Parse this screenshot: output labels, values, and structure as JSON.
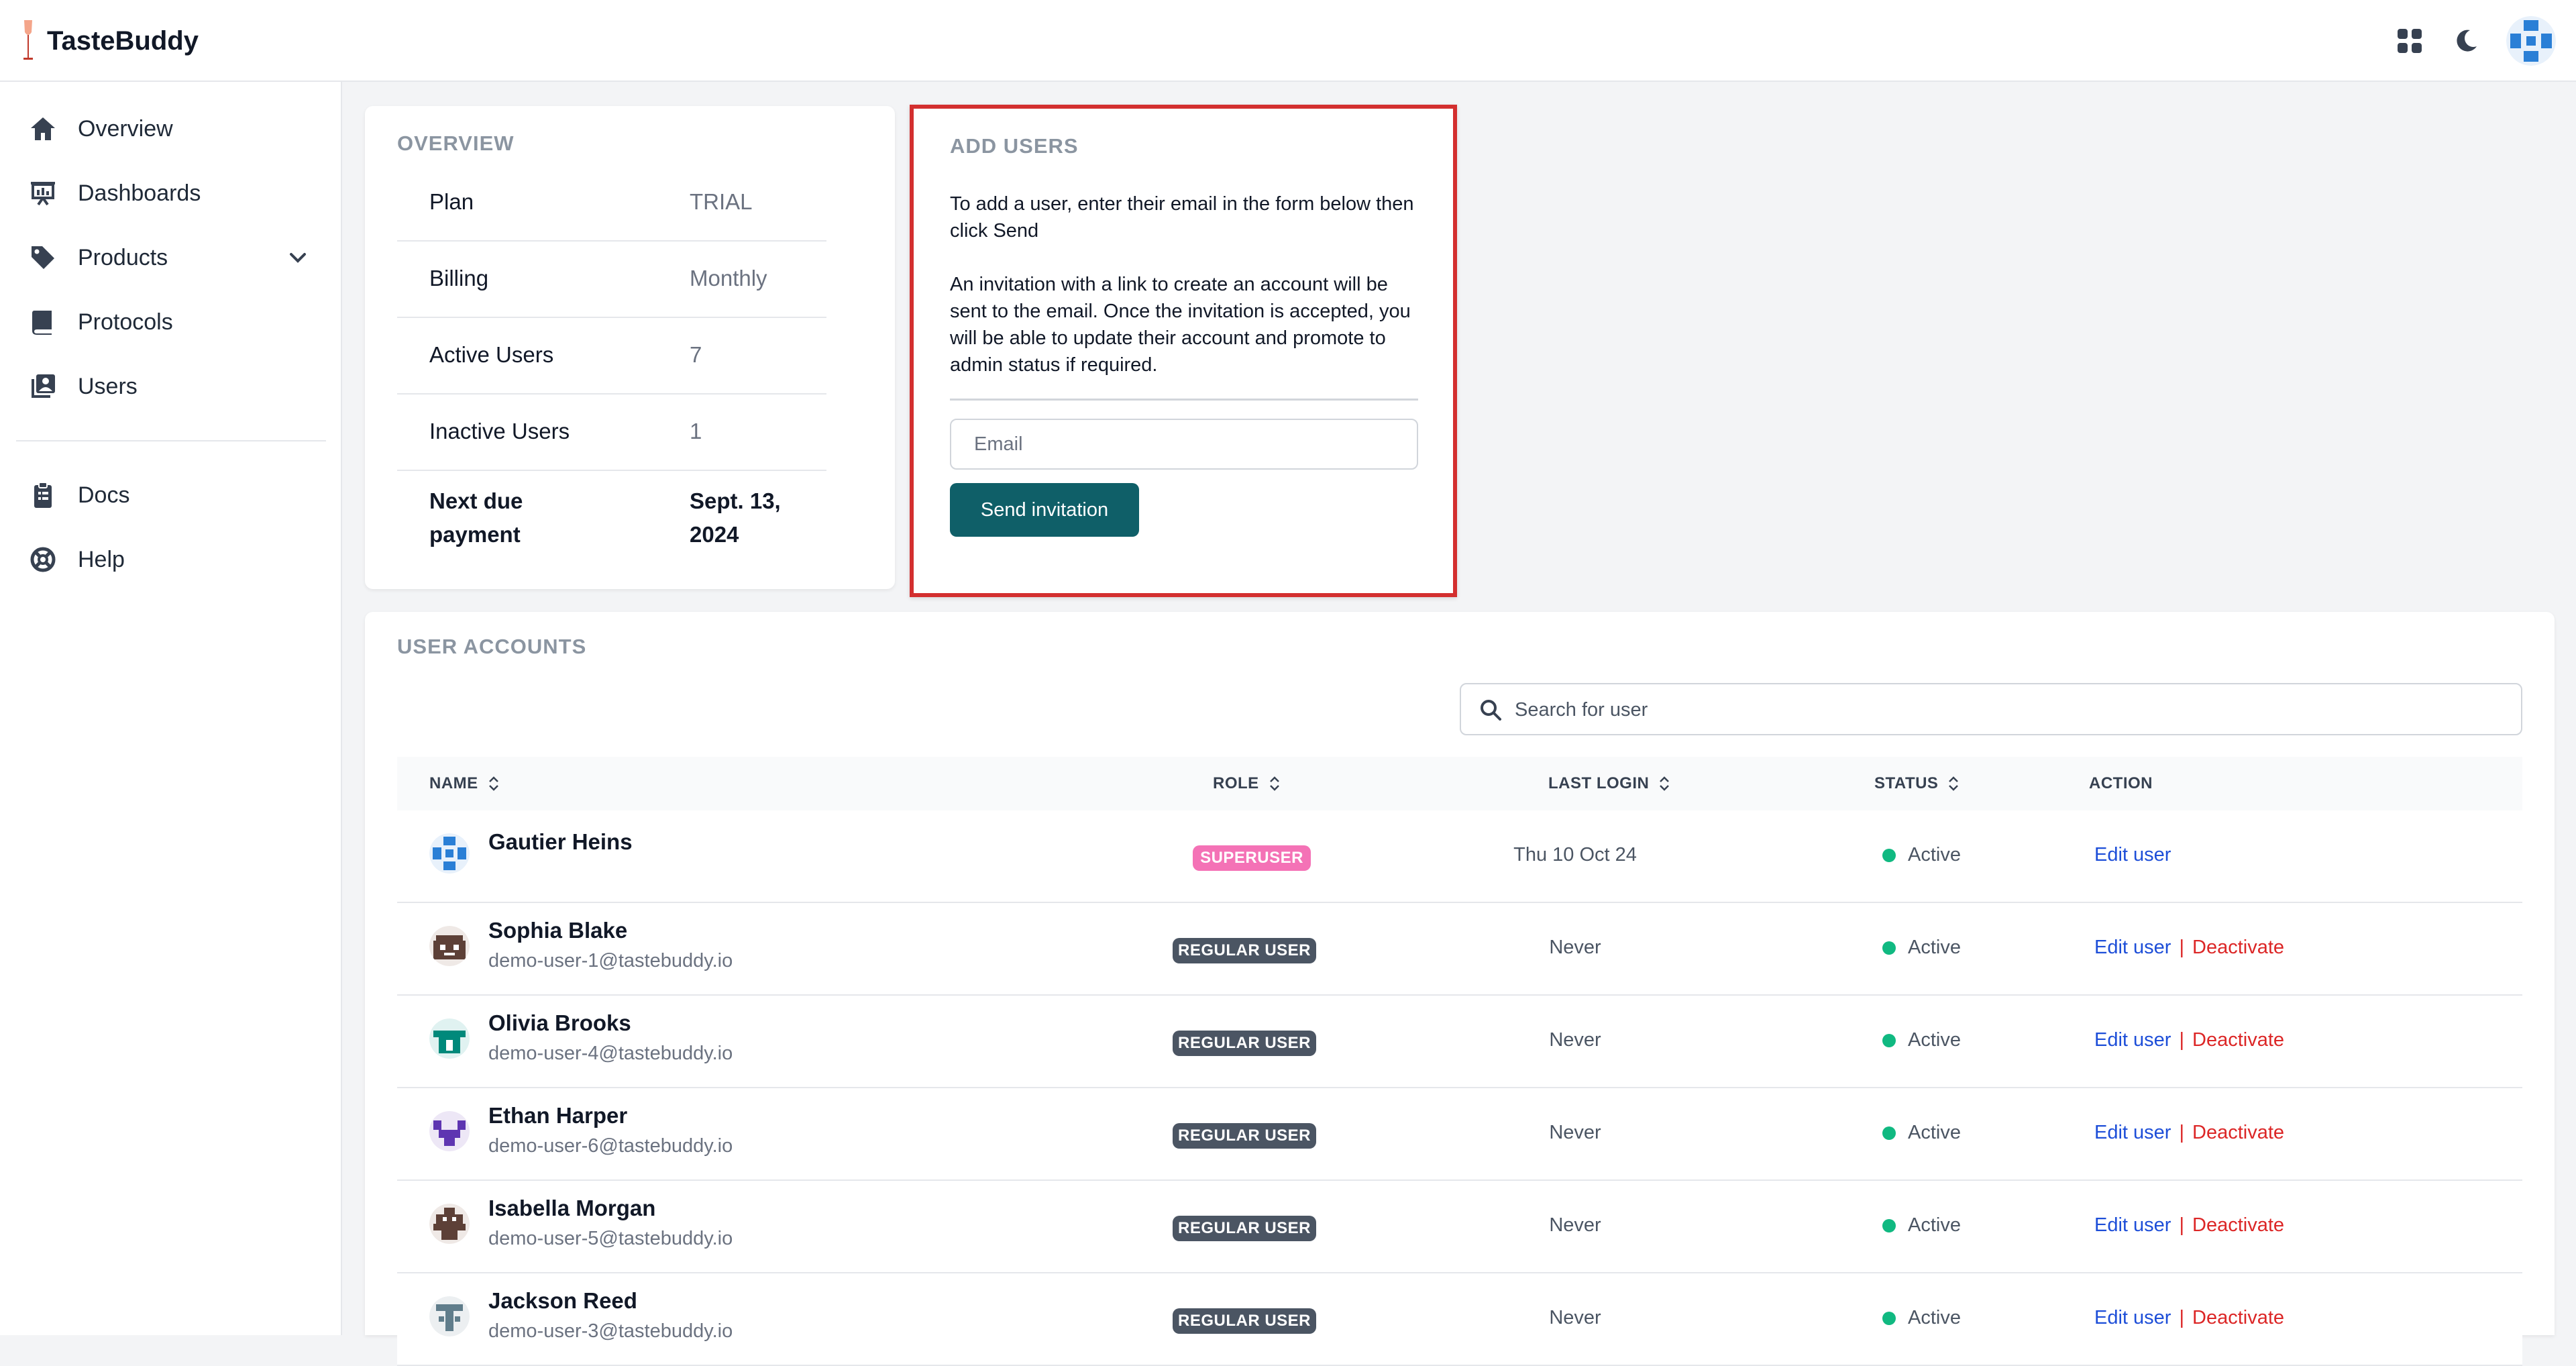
{
  "app": {
    "name": "TasteBuddy"
  },
  "colors": {
    "accent": "#0f5f68",
    "highlight_border": "#d32f2f",
    "active": "#10b981",
    "link": "#1d4ed8",
    "danger": "#dc2626",
    "superuser": "#f472b6",
    "regular": "#4b5563"
  },
  "header": {
    "icons": [
      "grid-icon",
      "moon-icon",
      "user-avatar"
    ]
  },
  "sidebar": {
    "items": [
      {
        "label": "Overview",
        "icon": "home-icon"
      },
      {
        "label": "Dashboards",
        "icon": "presentation-icon"
      },
      {
        "label": "Products",
        "icon": "tag-icon"
      },
      {
        "label": "Protocols",
        "icon": "book-icon"
      },
      {
        "label": "Users",
        "icon": "users-icon"
      }
    ],
    "footer_items": [
      {
        "label": "Docs",
        "icon": "clipboard-icon"
      },
      {
        "label": "Help",
        "icon": "lifebuoy-icon"
      }
    ]
  },
  "overview": {
    "title": "OVERVIEW",
    "rows": [
      {
        "label": "Plan",
        "value": "TRIAL"
      },
      {
        "label": "Billing",
        "value": "Monthly"
      },
      {
        "label": "Active Users",
        "value": "7"
      },
      {
        "label": "Inactive Users",
        "value": "1"
      }
    ],
    "next_due": {
      "label_line1": "Next due",
      "label_line2": "payment",
      "value_line1": "Sept. 13,",
      "value_line2": "2024"
    }
  },
  "add_users": {
    "title": "ADD USERS",
    "intro": "To add a user, enter their email in the form below then click Send",
    "detail": "An invitation with a link to create an account will be sent to the email. Once the invitation is accepted, you will be able to update their account and promote to admin status if required.",
    "email_placeholder": "Email",
    "send_label": "Send invitation"
  },
  "user_accounts": {
    "title": "USER ACCOUNTS",
    "search_placeholder": "Search for user",
    "columns": {
      "name": "NAME",
      "role": "ROLE",
      "last_login": "LAST LOGIN",
      "status": "STATUS",
      "action": "ACTION"
    },
    "edit_label": "Edit user",
    "separator": "|",
    "deactivate_label": "Deactivate",
    "rows": [
      {
        "name": "Gautier Heins",
        "email": "",
        "role": "SUPERUSER",
        "last_login": "Thu 10 Oct 24",
        "status": "Active"
      },
      {
        "name": "Sophia Blake",
        "email": "demo-user-1@tastebuddy.io",
        "role": "REGULAR USER",
        "last_login": "Never",
        "status": "Active"
      },
      {
        "name": "Olivia Brooks",
        "email": "demo-user-4@tastebuddy.io",
        "role": "REGULAR USER",
        "last_login": "Never",
        "status": "Active"
      },
      {
        "name": "Ethan Harper",
        "email": "demo-user-6@tastebuddy.io",
        "role": "REGULAR USER",
        "last_login": "Never",
        "status": "Active"
      },
      {
        "name": "Isabella Morgan",
        "email": "demo-user-5@tastebuddy.io",
        "role": "REGULAR USER",
        "last_login": "Never",
        "status": "Active"
      },
      {
        "name": "Jackson Reed",
        "email": "demo-user-3@tastebuddy.io",
        "role": "REGULAR USER",
        "last_login": "Never",
        "status": "Active"
      }
    ]
  }
}
